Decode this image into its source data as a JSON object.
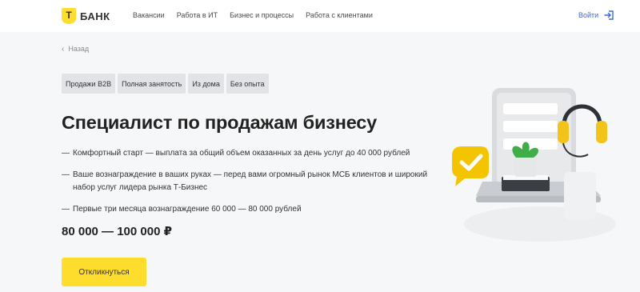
{
  "header": {
    "logo_letter": "Т",
    "logo_text": "БАНК",
    "nav": [
      "Вакансии",
      "Работа в ИТ",
      "Бизнес и процессы",
      "Работа с клиентами"
    ],
    "login_label": "Войти"
  },
  "back_label": "Назад",
  "tags": [
    "Продажи B2B",
    "Полная занятость",
    "Из дома",
    "Без опыта"
  ],
  "title": "Специалист по продажам бизнесу",
  "bullets": [
    "Комфортный старт — выплата за общий объем оказанных за день услуг до 40 000 рублей",
    "Ваше вознаграждение в ваших руках — перед вами огромный рынок МСБ клиентов и широкий набор услуг лидера рынка Т-Бизнес",
    "Первые три месяца вознаграждение 60 000 — 80 000 рублей"
  ],
  "salary": "80 000 — 100 000 ₽",
  "apply_label": "Откликнуться",
  "colors": {
    "brand_yellow": "#ffdd2d",
    "link_blue": "#3a6bd9",
    "page_bg": "#f6f7f8"
  },
  "icons": {
    "back": "chevron-left-icon",
    "login": "login-arrow-icon",
    "illustration": "laptop-headphones-illustration"
  }
}
